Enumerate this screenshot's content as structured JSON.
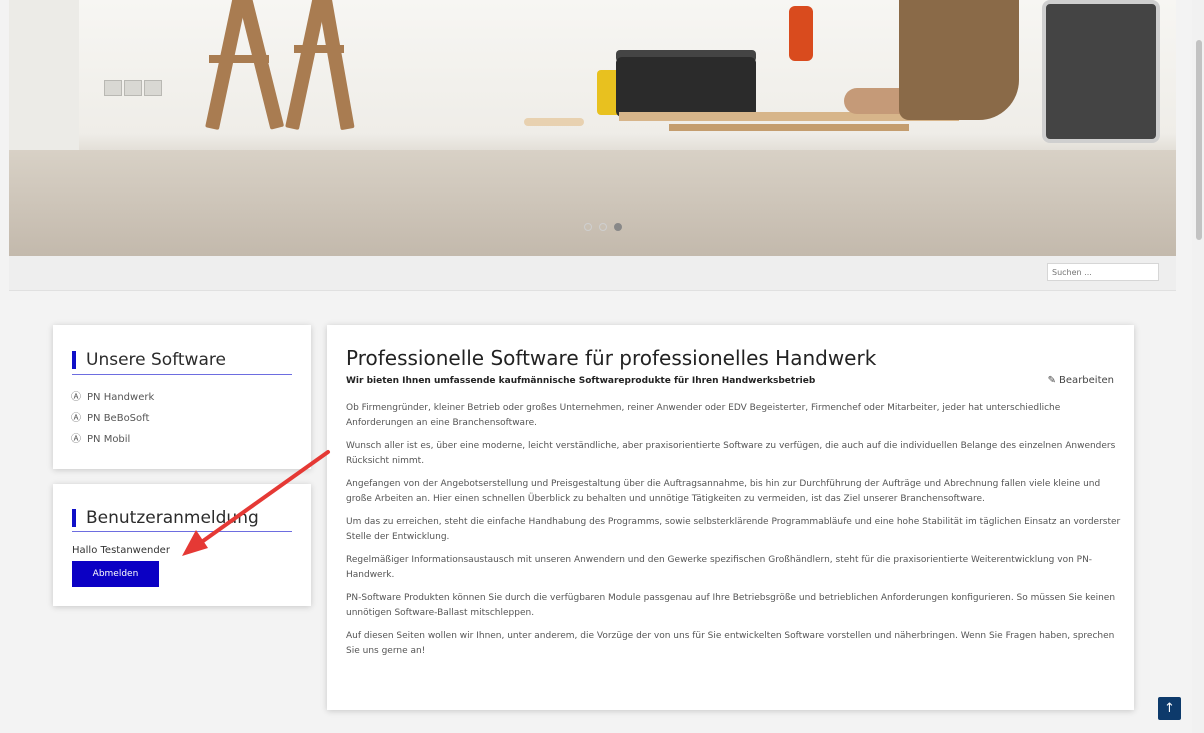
{
  "search": {
    "placeholder": "Suchen ..."
  },
  "slider": {
    "dots": 3,
    "active_index": 2
  },
  "sidebar": {
    "software": {
      "title": "Unsere Software",
      "items": [
        {
          "label": "PN Handwerk",
          "icon": "circle-a-icon"
        },
        {
          "label": "PN BeBoSoft",
          "icon": "circle-a-icon"
        },
        {
          "label": "PN Mobil",
          "icon": "circle-a-icon"
        }
      ]
    },
    "login": {
      "title": "Benutzeranmeldung",
      "greeting": "Hallo Testanwender",
      "logout_label": "Abmelden"
    }
  },
  "main": {
    "title": "Professionelle Software für professionelles Handwerk",
    "subtitle": "Wir bieten Ihnen umfassende kaufmännische Softwareprodukte für Ihren Handwerksbetrieb",
    "edit_label": "Bearbeiten",
    "paragraphs": [
      "Ob Firmengründer, kleiner Betrieb oder großes Unternehmen, reiner Anwender oder EDV Begeisterter, Firmenchef oder Mitarbeiter, jeder hat unterschiedliche Anforderungen an eine Branchensoftware.",
      "Wunsch aller ist es, über eine moderne, leicht verständliche, aber praxisorientierte Software zu verfügen, die auch auf die individuellen Belange des einzelnen Anwenders Rücksicht nimmt.",
      "Angefangen von der Angebotserstellung und Preisgestaltung über die Auftragsannahme, bis hin zur Durchführung der Aufträge und Abrechnung fallen viele kleine und große Arbeiten an. Hier einen schnellen Überblick zu behalten und unnötige Tätigkeiten zu vermeiden, ist das Ziel unserer Branchensoftware.",
      "Um das zu erreichen, steht die einfache Handhabung des Programms, sowie selbsterklärende Programmabläufe und eine hohe Stabilität im täglichen Einsatz an vorderster Stelle der Entwicklung.",
      "Regelmäßiger Informationsaustausch mit unseren Anwendern und den Gewerke spezifischen Großhändlern, steht für die praxisorientierte Weiterentwicklung von PN-Handwerk.",
      "PN-Software Produkten können Sie durch die verfügbaren Module passgenau auf Ihre Betriebsgröße und betrieblichen Anforderungen konfigurieren. So müssen Sie keinen unnötigen Software-Ballast mitschleppen.",
      "Auf diesen Seiten wollen wir Ihnen, unter anderem, die Vorzüge der von uns für Sie entwickelten Software vorstellen und näherbringen. Wenn Sie Fragen haben, sprechen Sie uns gerne an!"
    ]
  },
  "colors": {
    "accent": "#0b00c4",
    "annotation_arrow": "#e53935",
    "back_to_top": "#0d3a6b"
  }
}
